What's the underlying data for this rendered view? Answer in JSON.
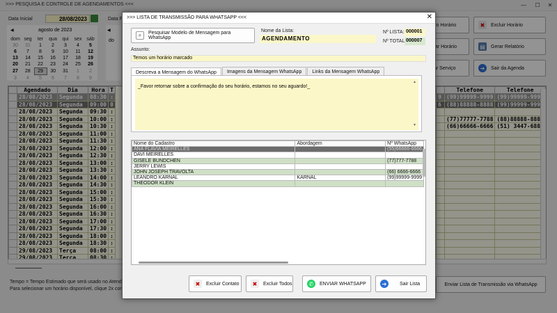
{
  "background": {
    "title": ">>> PESQUISA E CONTROLE DE AGENDAMENTOS <<<",
    "data_inicial_label": "Data Inicial",
    "data_inicial_value": "28/08/2023",
    "data_final_label": "Data F",
    "calendar": {
      "month_label": "agosto de 2023",
      "weekdays": [
        "dom",
        "seg",
        "ter",
        "qua",
        "qui",
        "sex",
        "sáb"
      ],
      "weeks": [
        [
          "30",
          "31",
          "1",
          "2",
          "3",
          "4",
          "5"
        ],
        [
          "6",
          "7",
          "8",
          "9",
          "10",
          "11",
          "12"
        ],
        [
          "13",
          "14",
          "15",
          "16",
          "17",
          "18",
          "19"
        ],
        [
          "20",
          "21",
          "22",
          "23",
          "24",
          "25",
          "26"
        ],
        [
          "27",
          "28",
          "29",
          "30",
          "31",
          "1",
          "2"
        ],
        [
          "3",
          "4",
          "5",
          "6",
          "7",
          "8",
          "9"
        ]
      ],
      "second_header": "do"
    },
    "grid": {
      "columns": [
        "Agendado",
        "Dia",
        "Hora",
        "T"
      ],
      "rows": [
        [
          "28/08/2023",
          "Segunda",
          "08:30",
          ":"
        ],
        [
          "28/08/2023",
          "Segunda",
          "09:00",
          "0"
        ],
        [
          "28/08/2023",
          "Segunda",
          "09:30",
          ":"
        ],
        [
          "28/08/2023",
          "Segunda",
          "10:00",
          ":"
        ],
        [
          "28/08/2023",
          "Segunda",
          "10:30",
          ":"
        ],
        [
          "28/08/2023",
          "Segunda",
          "11:00",
          ":"
        ],
        [
          "28/08/2023",
          "Segunda",
          "11:30",
          ":"
        ],
        [
          "28/08/2023",
          "Segunda",
          "12:00",
          ":"
        ],
        [
          "28/08/2023",
          "Segunda",
          "12:30",
          ":"
        ],
        [
          "28/08/2023",
          "Segunda",
          "13:00",
          ":"
        ],
        [
          "28/08/2023",
          "Segunda",
          "13:30",
          ":"
        ],
        [
          "28/08/2023",
          "Segunda",
          "14:00",
          ":"
        ],
        [
          "28/08/2023",
          "Segunda",
          "14:30",
          ":"
        ],
        [
          "28/08/2023",
          "Segunda",
          "15:00",
          ":"
        ],
        [
          "28/08/2023",
          "Segunda",
          "15:30",
          ":"
        ],
        [
          "28/08/2023",
          "Segunda",
          "16:00",
          ":"
        ],
        [
          "28/08/2023",
          "Segunda",
          "16:30",
          ":"
        ],
        [
          "28/08/2023",
          "Segunda",
          "17:00",
          ":"
        ],
        [
          "28/08/2023",
          "Segunda",
          "17:30",
          ":"
        ],
        [
          "28/08/2023",
          "Segunda",
          "18:00",
          ":"
        ],
        [
          "28/08/2023",
          "Segunda",
          "18:30",
          ":"
        ],
        [
          "29/08/2023",
          "Terça",
          "08:00",
          ":"
        ],
        [
          "29/08/2023",
          "Terça",
          "08:30",
          ":"
        ]
      ]
    },
    "right_grid": {
      "col_partial": "",
      "columns": [
        "Telefone",
        "Telefone"
      ],
      "rows": [
        [
          "9",
          "(99)99999-9999",
          "(99)99999-9999"
        ],
        [
          "6",
          "(88)88888-8888",
          "(99)99999-9999"
        ],
        [
          "",
          "",
          ""
        ],
        [
          "",
          "(77)77777-7788",
          "(88)88888-8888"
        ],
        [
          "",
          "(66)66666-6666",
          "(51) 3447-6881"
        ]
      ]
    },
    "buttons": {
      "novo_horario": "vo Horário",
      "excluir_horario": "Excluir Horário",
      "alterar_horario": "tar Horário",
      "gerar_relatorio": "Gerar Relatório",
      "servico": "ar Serviço",
      "sair_agenda": "Sair da Agenda",
      "enviar_lista": "Enviar Lista de Transmissão via WhatsApp"
    },
    "footer_line1": "Tempo = Tempo Estimado que será usado no Atendiment",
    "footer_line2": "Para selecionar um horário disponível, clique 2x com o m"
  },
  "dialog": {
    "title": ">>> LISTA DE TRANSMISSÃO PARA WHATSAPP <<<",
    "search_button": "Pesquisar Modelo de Mensagem para WhatsApp",
    "nome_lista_label": "Nome da Lista:",
    "nome_lista_value": "AGENDAMENTO",
    "n_lista_label": "Nº LISTA:",
    "n_lista_value": "000001",
    "n_total_label": "Nº TOTAL:",
    "n_total_value": "000007",
    "assunto_label": "Assunto:",
    "assunto_value": "Temos um horário marcado",
    "tabs": [
      "Descreva a Mensagem do WhatsApp",
      "Imagens da Mensagem WhatsApp",
      "Links da Mensagem WhatsApp"
    ],
    "message": "_Favor retornar sobre a confirmação do seu horário, estamos no seu aguardo!_",
    "list_columns": [
      "Nome do Cadastro",
      "Abordagem",
      "Nº WhatsApp"
    ],
    "list_rows": [
      {
        "name": "ANA FLAVIA MEIRELLES",
        "abordagem": "",
        "whats": "(55)66666-6666",
        "style": "sel"
      },
      {
        "name": "DAVI MEIRELLES",
        "abordagem": "",
        "whats": "",
        "style": "white"
      },
      {
        "name": "GISELE BUNDCHEN",
        "abordagem": "",
        "whats": "(77)777-7788",
        "style": "green"
      },
      {
        "name": "JERRY LEWIS",
        "abordagem": "",
        "whats": "",
        "style": "white"
      },
      {
        "name": "JOHN JOSEPH TRAVOLTA",
        "abordagem": "",
        "whats": "(66) 6666-6666",
        "style": "green"
      },
      {
        "name": "LEANDRO KARNAL",
        "abordagem": "KARNAL",
        "whats": "(99)99999-9999",
        "style": "white"
      },
      {
        "name": "THEODOR KLEIN",
        "abordagem": "",
        "whats": "",
        "style": "green"
      }
    ],
    "buttons": {
      "excluir_contato": "Excluir Contato",
      "excluir_todos": "Excluir Todos",
      "enviar_whatsapp": "ENVIAR WHATSAPP",
      "sair_lista": "Sair Lista"
    },
    "colors": {
      "accent_yellow": "#fbf7c8",
      "selected_row": "#6c6c6c",
      "green_row": "#cfe0c6",
      "whatsapp_green": "#25d366"
    }
  }
}
